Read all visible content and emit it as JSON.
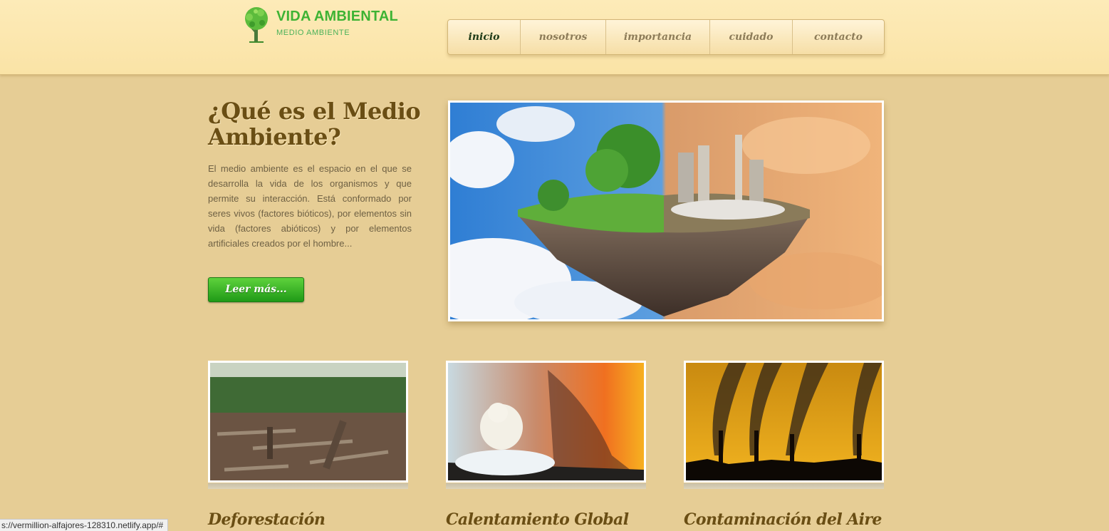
{
  "brand": {
    "title": "VIDA AMBIENTAL",
    "subtitle": "MEDIO AMBIENTE",
    "logo_icon": "tree-icon",
    "color": "#3eb334"
  },
  "nav": {
    "items": [
      {
        "label": "inicio",
        "active": true
      },
      {
        "label": "nosotros"
      },
      {
        "label": "importancia"
      },
      {
        "label": "cuidado"
      },
      {
        "label": "contacto"
      }
    ]
  },
  "hero": {
    "title": "¿Qué es el Medio Ambiente?",
    "text": "El medio ambiente es el espacio en el que se desarrolla la vida de los organismos y que permite su interacción. Está conformado por seres vivos (factores bióticos), por elementos sin vida (factores abióticos) y por elementos artificiales creados por el hombre...",
    "button_label": "Leer más...",
    "image": "floating-island-nature-vs-pollution-image"
  },
  "cards": [
    {
      "title": "Deforestación",
      "image": "deforestation-image"
    },
    {
      "title": "Calentamiento Global",
      "image": "polar-bear-global-warming-image"
    },
    {
      "title": "Contaminación del Aire",
      "image": "factory-smoke-image"
    }
  ],
  "status_bar": {
    "url": "s://vermillion-alfajores-128310.netlify.app/#"
  }
}
